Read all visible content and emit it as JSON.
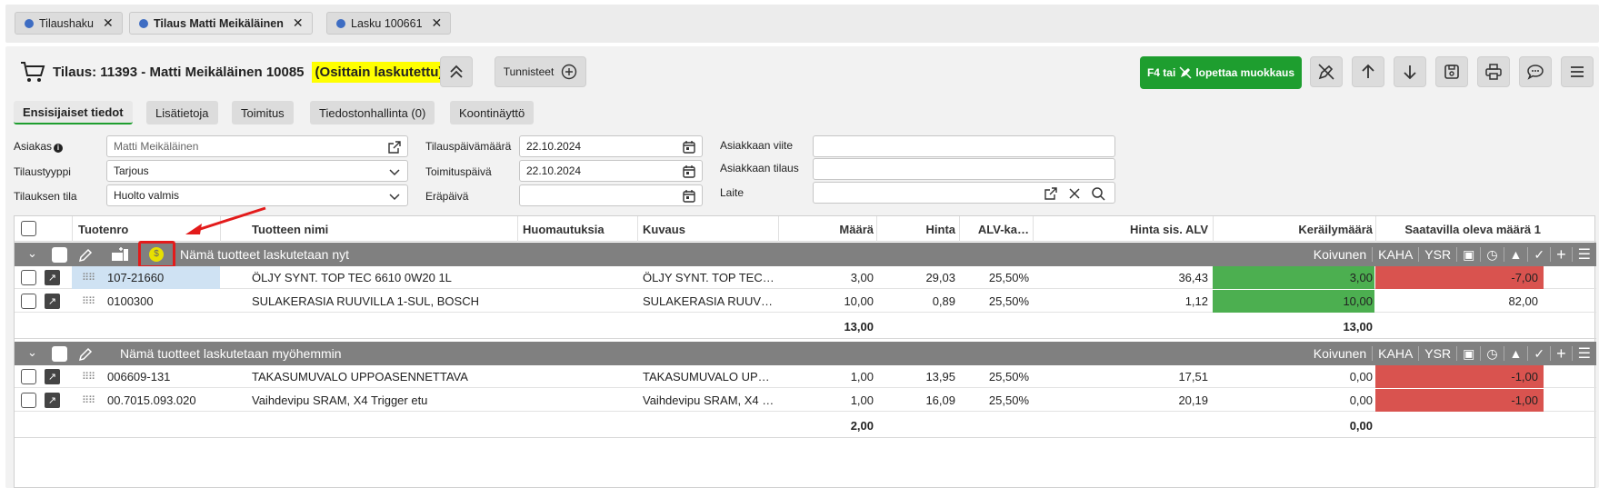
{
  "tabs": [
    {
      "label": "Tilaushaku"
    },
    {
      "label": "Tilaus Matti Meikäläinen"
    },
    {
      "label": "Lasku 100661"
    }
  ],
  "header": {
    "title": "Tilaus: 11393 - Matti Meikäläinen 10085",
    "status": "(Osittain laskutettu)",
    "tunnisteet": "Tunnisteet",
    "f4_label": "F4 tai",
    "f4_label2": "lopettaa muokkaus"
  },
  "subtabs": [
    "Ensisijaiset tiedot",
    "Lisätietoja",
    "Toimitus",
    "Tiedostonhallinta (0)",
    "Koontinäyttö"
  ],
  "form": {
    "asiakas_label": "Asiakas",
    "asiakas_value": "Matti Meikäläinen",
    "tilaustyyppi_label": "Tilaustyyppi",
    "tilaustyyppi_value": "Tarjous",
    "tila_label": "Tilauksen tila",
    "tila_value": "Huolto valmis",
    "tilauspvm_label": "Tilauspäivämäärä",
    "tilauspvm_value": "22.10.2024",
    "toimituspvm_label": "Toimituspäivä",
    "toimituspvm_value": "22.10.2024",
    "erapaiva_label": "Eräpäivä",
    "erapaiva_value": "",
    "viite_label": "Asiakkaan viite",
    "viite_value": "",
    "astilaus_label": "Asiakkaan tilaus",
    "astilaus_value": "",
    "laite_label": "Laite",
    "laite_value": ""
  },
  "columns": [
    "Tuotenro",
    "Tuotteen nimi",
    "Huomautuksia",
    "Kuvaus",
    "Määrä",
    "Hinta",
    "ALV-ka…",
    "Hinta sis. ALV",
    "Keräilymäärä",
    "Saatavilla oleva määrä 1"
  ],
  "group_icons": {
    "koivunen": "Koivunen",
    "kaha": "KAHA",
    "ysr": "YSR"
  },
  "groups": [
    {
      "title": "Nämä tuotteet laskutetaan nyt",
      "rows": [
        {
          "tuotenro": "107-21660",
          "nimi": "ÖLJY SYNT. TOP TEC 6610 0W20 1L",
          "huom": "",
          "kuvaus": "ÖLJY SYNT. TOP TEC…",
          "maara": "3,00",
          "hinta": "29,03",
          "alv": "25,50%",
          "hinta_alv": "36,43",
          "kerailymaara": "3,00",
          "saatavilla": "-7,00"
        },
        {
          "tuotenro": "0100300",
          "nimi": "SULAKERASIA RUUVILLA 1-SUL, BOSCH",
          "huom": "",
          "kuvaus": "SULAKERASIA RUUV…",
          "maara": "10,00",
          "hinta": "0,89",
          "alv": "25,50%",
          "hinta_alv": "1,12",
          "kerailymaara": "10,00",
          "saatavilla": "82,00"
        }
      ],
      "sum_maara": "13,00",
      "sum_kerailymaara": "13,00"
    },
    {
      "title": "Nämä tuotteet laskutetaan myöhemmin",
      "rows": [
        {
          "tuotenro": "006609-131",
          "nimi": "TAKASUMUVALO UPPOASENNETTAVA",
          "huom": "",
          "kuvaus": "TAKASUMUVALO UP…",
          "maara": "1,00",
          "hinta": "13,95",
          "alv": "25,50%",
          "hinta_alv": "17,51",
          "kerailymaara": "0,00",
          "saatavilla": "-1,00"
        },
        {
          "tuotenro": "00.7015.093.020",
          "nimi": "Vaihdevipu SRAM, X4 Trigger etu",
          "huom": "",
          "kuvaus": "Vaihdevipu SRAM, X4 …",
          "maara": "1,00",
          "hinta": "16,09",
          "alv": "25,50%",
          "hinta_alv": "20,19",
          "kerailymaara": "0,00",
          "saatavilla": "-1,00"
        }
      ],
      "sum_maara": "2,00",
      "sum_kerailymaara": "0,00"
    }
  ],
  "colors": {
    "green": "#1e9e2f",
    "cell_green": "#4caf50",
    "cell_red": "#d9534f",
    "highlight": "#ffff00",
    "group_bg": "#808080",
    "annotation_red": "#e31b1b"
  }
}
